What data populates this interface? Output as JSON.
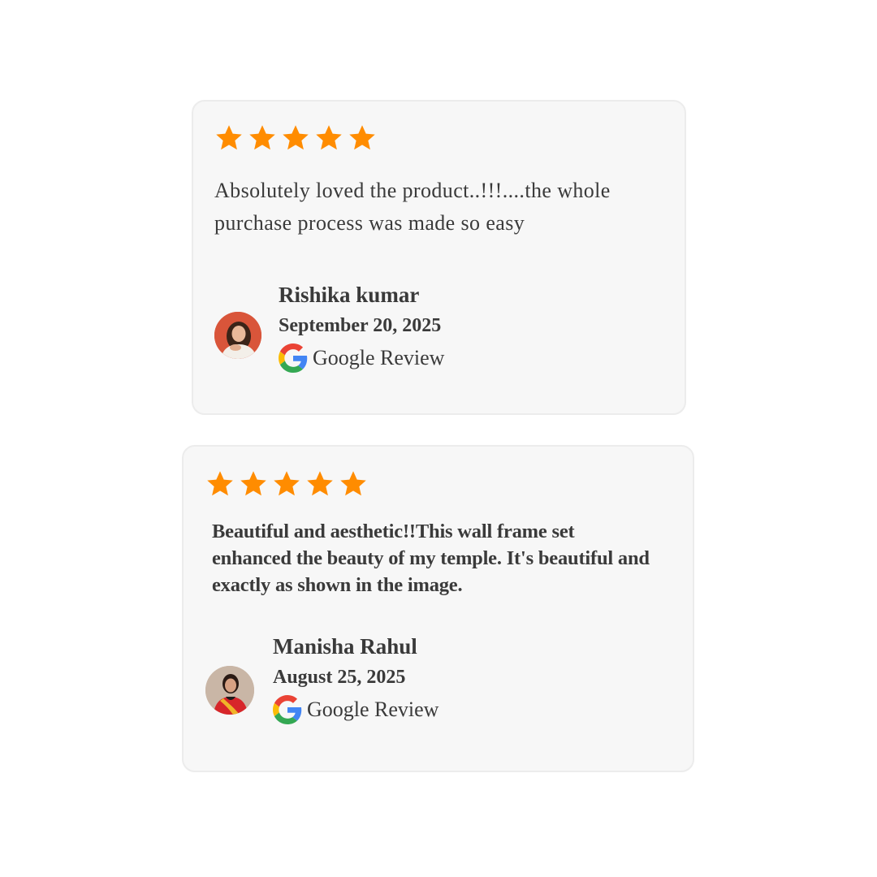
{
  "colors": {
    "star": "#ff8c00",
    "card_bg": "#f7f7f7",
    "text": "#3a3a3a"
  },
  "reviews": [
    {
      "rating": 5,
      "text": "Absolutely loved the product..!!!....the whole purchase process was made so easy",
      "name": "Rishika kumar",
      "date": "September 20, 2025",
      "source": "Google Review",
      "avatar_icon": "profile-photo-woman"
    },
    {
      "rating": 5,
      "text": "Beautiful and aesthetic!!This wall frame set enhanced the beauty of my temple. It's beautiful and exactly as shown in the image.",
      "name": "Manisha Rahul",
      "date": "August 25, 2025",
      "source": "Google Review",
      "avatar_icon": "profile-photo-woman-saree"
    }
  ]
}
